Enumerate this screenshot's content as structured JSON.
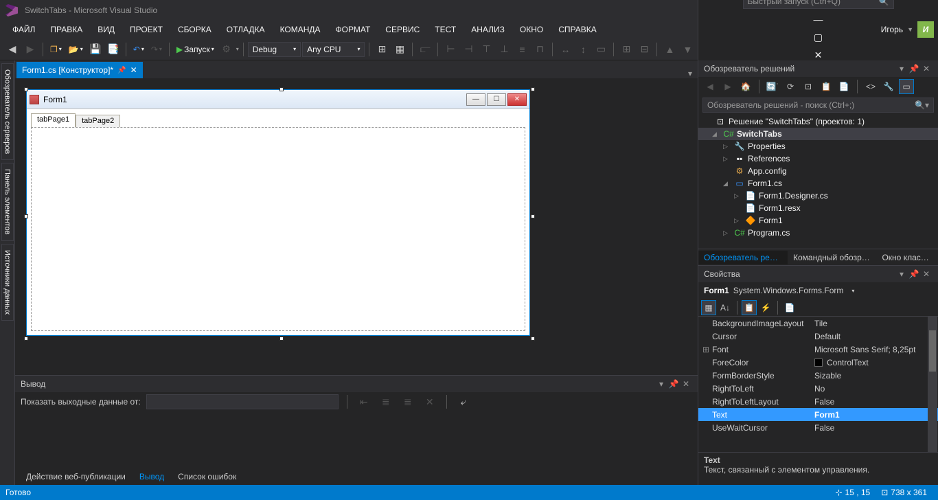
{
  "app": {
    "title": "SwitchTabs - Microsoft Visual Studio",
    "quicklaunch_placeholder": "Быстрый запуск (Ctrl+Q)",
    "user": "Игорь",
    "user_initial": "И"
  },
  "menu": [
    "ФАЙЛ",
    "ПРАВКА",
    "ВИД",
    "ПРОЕКТ",
    "СБОРКА",
    "ОТЛАДКА",
    "КОМАНДА",
    "ФОРМАТ",
    "СЕРВИС",
    "ТЕСТ",
    "АНАЛИЗ",
    "ОКНО",
    "СПРАВКА"
  ],
  "toolbar": {
    "start": "Запуск",
    "config": "Debug",
    "platform": "Any CPU"
  },
  "document_tab": {
    "title": "Form1.cs [Конструктор]*"
  },
  "left_dock": {
    "tab1": "Обозреватель серверов",
    "tab2": "Панель элементов",
    "tab3": "Источники данных"
  },
  "form": {
    "title": "Form1",
    "tabs": [
      "tabPage1",
      "tabPage2"
    ]
  },
  "output": {
    "header": "Вывод",
    "show_from": "Показать выходные данные от:"
  },
  "bottom_tabs": {
    "t1": "Действие веб-публикации",
    "t2": "Вывод",
    "t3": "Список ошибок"
  },
  "solution_explorer": {
    "title": "Обозреватель решений",
    "search_placeholder": "Обозреватель решений - поиск (Ctrl+;)",
    "sln": "Решение \"SwitchTabs\" (проектов: 1)",
    "proj": "SwitchTabs",
    "items": {
      "properties": "Properties",
      "references": "References",
      "appconfig": "App.config",
      "form1cs": "Form1.cs",
      "designer": "Form1.Designer.cs",
      "resx": "Form1.resx",
      "form1cls": "Form1",
      "program": "Program.cs"
    },
    "tabs": {
      "t1": "Обозреватель реше...",
      "t2": "Командный обозре...",
      "t3": "Окно классов"
    }
  },
  "properties": {
    "title": "Свойства",
    "object_name": "Form1",
    "object_type": "System.Windows.Forms.Form",
    "rows": [
      {
        "name": "BackgroundImageLayout",
        "value": "Tile"
      },
      {
        "name": "Cursor",
        "value": "Default"
      },
      {
        "name": "Font",
        "value": "Microsoft Sans Serif; 8,25pt",
        "expand": true
      },
      {
        "name": "ForeColor",
        "value": "ControlText",
        "color": "#000"
      },
      {
        "name": "FormBorderStyle",
        "value": "Sizable"
      },
      {
        "name": "RightToLeft",
        "value": "No"
      },
      {
        "name": "RightToLeftLayout",
        "value": "False"
      },
      {
        "name": "Text",
        "value": "Form1",
        "selected": true
      },
      {
        "name": "UseWaitCursor",
        "value": "False"
      }
    ],
    "help_name": "Text",
    "help_desc": "Текст, связанный с элементом управления."
  },
  "statusbar": {
    "ready": "Готово",
    "pos": "15 , 15",
    "size": "738 x 361"
  }
}
